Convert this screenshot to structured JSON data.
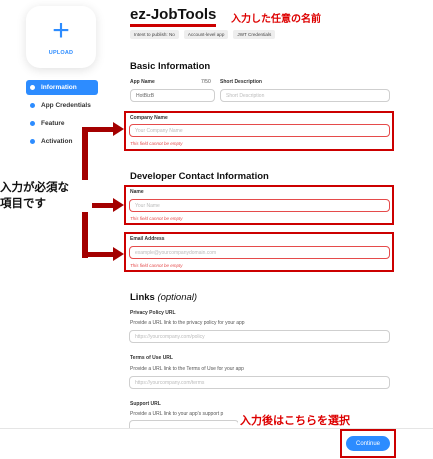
{
  "upload": {
    "label": "UPLOAD",
    "icon": "plus-icon"
  },
  "sidebar": {
    "items": [
      {
        "label": "Information",
        "active": true
      },
      {
        "label": "App Credentials",
        "active": false
      },
      {
        "label": "Feature",
        "active": false
      },
      {
        "label": "Activation",
        "active": false
      }
    ]
  },
  "header": {
    "title": "ez-JobTools",
    "tags": [
      "Intent to publish: No",
      "Account-level app",
      "JWT Credentials"
    ]
  },
  "annotations": {
    "name_note": "入力した任意の名前",
    "required_note_line1": "入力が必須な",
    "required_note_line2": "項目です",
    "select_note": "入力後はこちらを選択"
  },
  "basic_info": {
    "title": "Basic Information",
    "app_name_label": "App Name",
    "app_name_value": "HotBizB",
    "app_name_counter": "7/50",
    "short_desc_label": "Short Description",
    "short_desc_placeholder": "Short Description",
    "company_label": "Company Name",
    "company_placeholder": "Your Company Name",
    "company_error": "This field cannot be empty"
  },
  "developer": {
    "title": "Developer Contact Information",
    "name_label": "Name",
    "name_placeholder": "Your Name",
    "name_error": "This field cannot be empty",
    "email_label": "Email Address",
    "email_placeholder": "example@yourcompanydomain.com",
    "email_error": "This field cannot be empty"
  },
  "links": {
    "title": "Links",
    "title_suffix": "(optional)",
    "privacy_label": "Privacy Policy URL",
    "privacy_help": "Provide a URL link to the privacy policy for your app",
    "privacy_placeholder": "https://yourcompany.com/policy",
    "terms_label": "Terms of Use URL",
    "terms_help": "Provide a URL link to the Terms of Use for your app",
    "terms_placeholder": "https://yourcompany.com/terms",
    "support_label": "Support URL",
    "support_help": "Provide a URL link to your app's support p"
  },
  "footer": {
    "continue_label": "Continue"
  },
  "colors": {
    "accent": "#2d8cff",
    "error": "#e54b4b",
    "annotation": "#cc0000",
    "arrow": "#a40000"
  }
}
